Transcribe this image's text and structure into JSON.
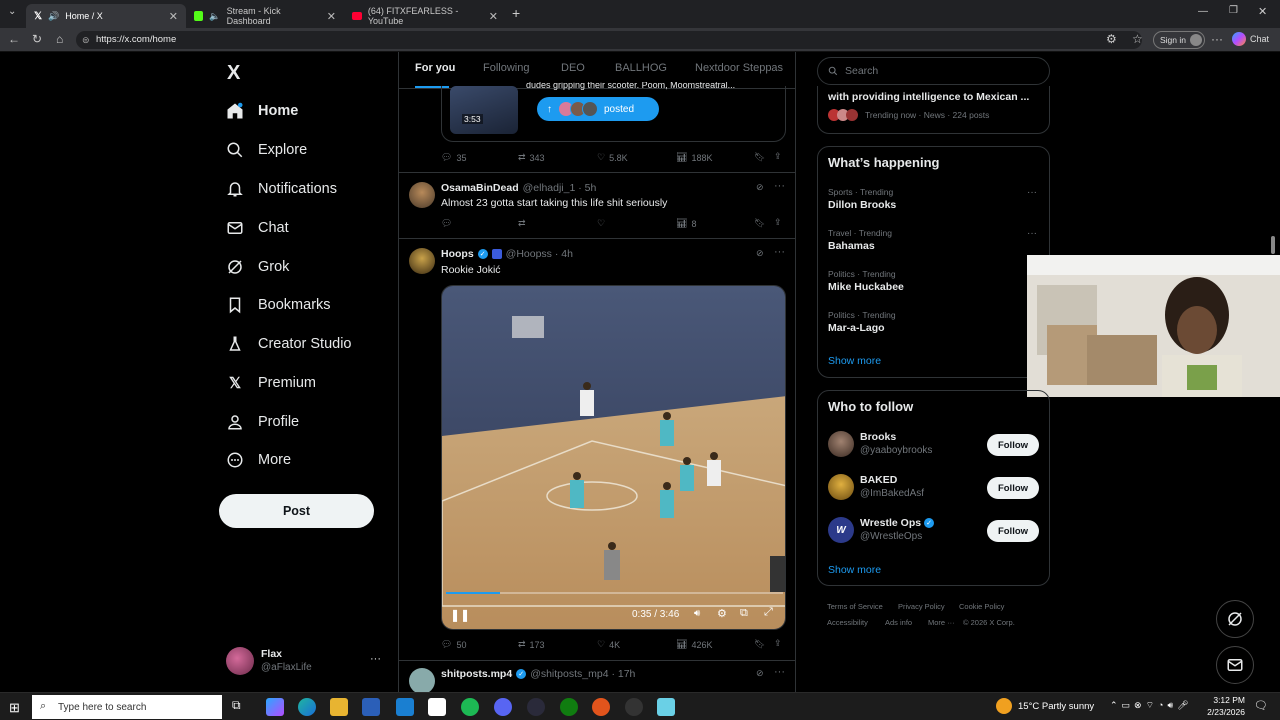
{
  "browser": {
    "tabs": [
      {
        "title": "Home / X",
        "active": true
      },
      {
        "title": "Stream - Kick Dashboard",
        "active": false
      },
      {
        "title": "(64) FITXFEARLESS - YouTube",
        "active": false
      }
    ],
    "url": "https://x.com/home",
    "sign_in_label": "Sign in",
    "chat_label": "Chat"
  },
  "sidebar": {
    "logo": "X",
    "items": [
      {
        "label": "Home",
        "icon": "home-icon"
      },
      {
        "label": "Explore",
        "icon": "search-icon"
      },
      {
        "label": "Notifications",
        "icon": "bell-icon"
      },
      {
        "label": "Chat",
        "icon": "mail-icon"
      },
      {
        "label": "Grok",
        "icon": "grok-icon"
      },
      {
        "label": "Bookmarks",
        "icon": "bookmark-icon"
      },
      {
        "label": "Creator Studio",
        "icon": "flask-icon"
      },
      {
        "label": "Premium",
        "icon": "x-icon"
      },
      {
        "label": "Profile",
        "icon": "person-icon"
      },
      {
        "label": "More",
        "icon": "more-circle-icon"
      }
    ],
    "post_label": "Post",
    "account": {
      "name": "Flax",
      "handle": "@aFlaxLife",
      "menu": "···"
    }
  },
  "feed": {
    "tabs": [
      "For you",
      "Following",
      "DEO",
      "BALLHOG",
      "Nextdoor Steppas"
    ],
    "quoted_duration": "3:53",
    "quoted_text": "dudes gripping their scooter. Poom, Moomstreatral...",
    "posted_pill": "posted",
    "tweet1_stats": {
      "replies": "35",
      "reposts": "343",
      "likes": "5.8K",
      "views": "188K"
    },
    "tweet2": {
      "name": "OsamaBinDead",
      "handle": "@elhadji_1 · 5h",
      "text": "Almost 23 gotta start taking this life shit seriously",
      "views": "8"
    },
    "tweet3": {
      "name": "Hoops",
      "handle": "@Hoopss · 4h",
      "text": "Rookie Jokić",
      "video_time": "0:35 / 3:46",
      "progress": 0.16,
      "stats": {
        "replies": "50",
        "reposts": "173",
        "likes": "4K",
        "views": "426K"
      }
    },
    "tweet4": {
      "name": "shitposts.mp4",
      "handle": "@shitposts_mp4 · 17h"
    }
  },
  "right": {
    "search_placeholder": "Search",
    "top_trend": {
      "text": "with providing intelligence to Mexican ...",
      "meta": "Trending now · News · 224 posts"
    },
    "whats_happening_title": "What’s happening",
    "trends": [
      {
        "meta": "Sports · Trending",
        "name": "Dillon Brooks"
      },
      {
        "meta": "Travel · Trending",
        "name": "Bahamas"
      },
      {
        "meta": "Politics · Trending",
        "name": "Mike Huckabee"
      },
      {
        "meta": "Politics · Trending",
        "name": "Mar-a-Lago"
      }
    ],
    "show_more": "Show more",
    "who_to_follow_title": "Who to follow",
    "follow": [
      {
        "name": "Brooks",
        "handle": "@yaaboybrooks"
      },
      {
        "name": "BAKED",
        "handle": "@ImBakedAsf"
      },
      {
        "name": "Wrestle Ops",
        "handle": "@WrestleOps"
      }
    ],
    "follow_label": "Follow",
    "footer": [
      "Terms of Service",
      "Privacy Policy",
      "Cookie Policy",
      "Accessibility",
      "Ads info",
      "More ···",
      "© 2026 X Corp."
    ]
  },
  "taskbar": {
    "search_placeholder": "Type here to search",
    "weather": "15°C  Partly sunny",
    "time": "3:12 PM",
    "date": "2/23/2026"
  }
}
